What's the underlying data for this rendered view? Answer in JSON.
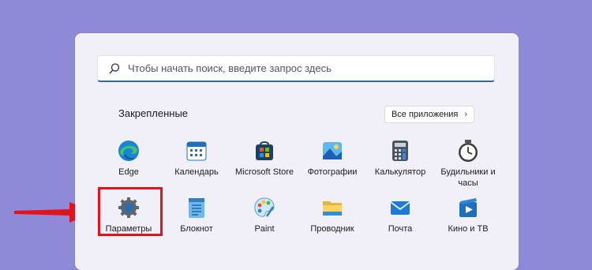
{
  "search": {
    "placeholder": "Чтобы начать поиск, введите запрос здесь",
    "icon": "search-icon"
  },
  "pinned": {
    "title": "Закрепленные",
    "all_apps_label": "Все приложения",
    "apps_row1": [
      {
        "label": "Edge",
        "icon": "edge-icon"
      },
      {
        "label": "Календарь",
        "icon": "calendar-icon"
      },
      {
        "label": "Microsoft Store",
        "icon": "store-icon"
      },
      {
        "label": "Фотографии",
        "icon": "photos-icon"
      },
      {
        "label": "Калькулятор",
        "icon": "calculator-icon"
      },
      {
        "label": "Будильники и часы",
        "icon": "clock-icon"
      }
    ],
    "apps_row2": [
      {
        "label": "Параметры",
        "icon": "settings-gear-icon"
      },
      {
        "label": "Блокнот",
        "icon": "notepad-icon"
      },
      {
        "label": "Paint",
        "icon": "paint-icon"
      },
      {
        "label": "Проводник",
        "icon": "folder-icon"
      },
      {
        "label": "Почта",
        "icon": "mail-icon"
      },
      {
        "label": "Кино и ТВ",
        "icon": "movies-icon"
      }
    ]
  },
  "colors": {
    "background": "#8f8ad8",
    "highlight": "#e0141c",
    "accent": "#2d6b9a"
  }
}
